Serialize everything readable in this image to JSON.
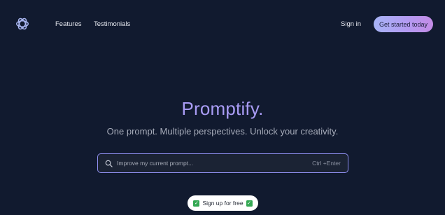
{
  "nav": {
    "logo_icon": "openai-logo-icon",
    "links": [
      "Features",
      "Testimonials"
    ],
    "signin_label": "Sign in",
    "cta_label": "Get started today"
  },
  "hero": {
    "title": "Promptify.",
    "subtitle": "One prompt. Multiple perspectives. Unlock your creativity."
  },
  "search": {
    "icon": "search-icon",
    "placeholder": "Improve my current prompt...",
    "value": "",
    "shortcut": "Ctrl +Enter"
  },
  "signup": {
    "label": "Sign up for free",
    "icon": "check-mark-icon",
    "check_glyph": "✓"
  },
  "colors": {
    "background": "#111a2f",
    "accent": "#a99cf5",
    "cta_gradient_start": "#a7b4f6",
    "cta_gradient_end": "#c38be6",
    "search_border": "#8f8ff0",
    "check_green": "#34a853"
  }
}
